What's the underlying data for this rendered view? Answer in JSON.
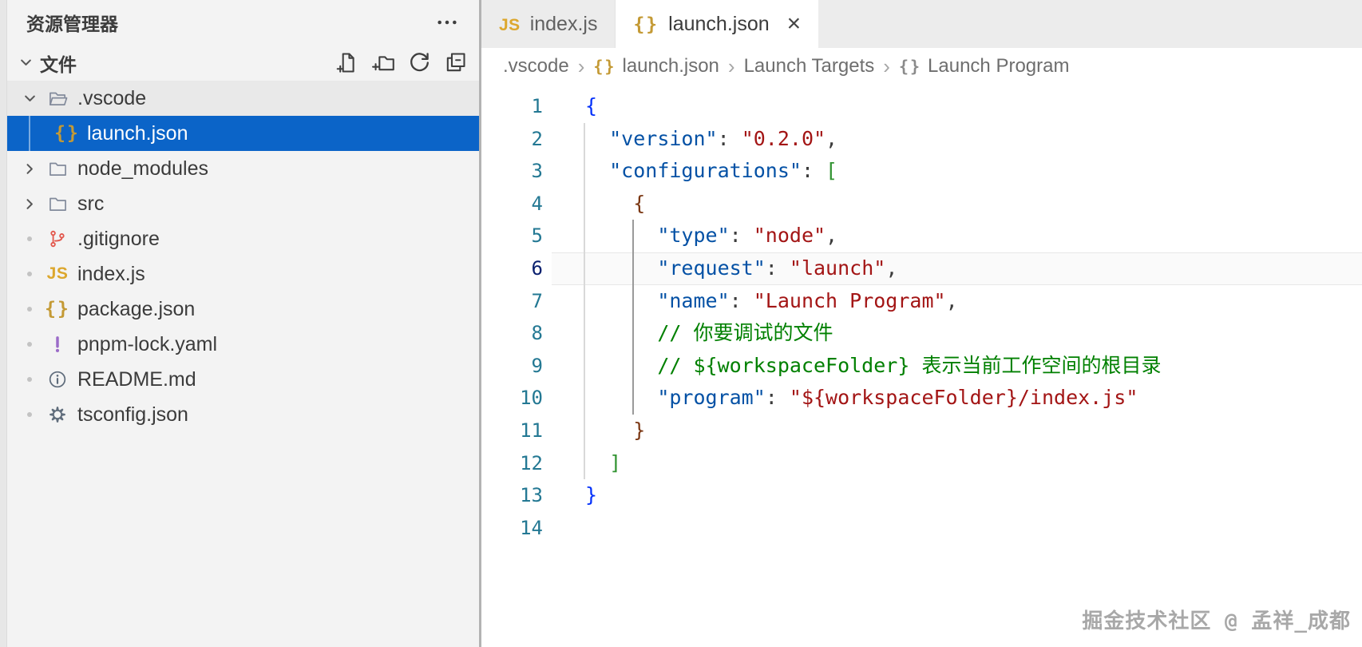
{
  "sidebar": {
    "title": "资源管理器",
    "more_icon": "ellipsis-icon",
    "section": {
      "label": "文件",
      "twisty_icon": "chevron-down-icon",
      "actions": [
        {
          "icon": "new-file-icon"
        },
        {
          "icon": "new-folder-icon"
        },
        {
          "icon": "refresh-icon"
        },
        {
          "icon": "collapse-all-icon"
        }
      ]
    },
    "tree": [
      {
        "label": ".vscode",
        "depth": 0,
        "twisty": "chevron-down-icon",
        "icon": "folder-open-icon",
        "shade": true
      },
      {
        "label": "launch.json",
        "depth": 1,
        "icon": "json-braces-icon",
        "selected": true
      },
      {
        "label": "node_modules",
        "depth": 0,
        "twisty": "chevron-right-icon",
        "icon": "folder-icon"
      },
      {
        "label": "src",
        "depth": 0,
        "twisty": "chevron-right-icon",
        "icon": "folder-icon"
      },
      {
        "label": ".gitignore",
        "depth": 0,
        "dot": true,
        "icon": "git-branch-icon"
      },
      {
        "label": "index.js",
        "depth": 0,
        "dot": true,
        "icon": "js-icon"
      },
      {
        "label": "package.json",
        "depth": 0,
        "dot": true,
        "icon": "json-braces-icon"
      },
      {
        "label": "pnpm-lock.yaml",
        "depth": 0,
        "dot": true,
        "icon": "exclamation-icon"
      },
      {
        "label": "README.md",
        "depth": 0,
        "dot": true,
        "icon": "info-icon"
      },
      {
        "label": "tsconfig.json",
        "depth": 0,
        "dot": true,
        "icon": "gear-icon"
      }
    ]
  },
  "editor": {
    "tabs": [
      {
        "label": "index.js",
        "icon": "js-icon",
        "active": false
      },
      {
        "label": "launch.json",
        "icon": "json-braces-icon",
        "active": true,
        "close_icon": "close-icon",
        "close_glyph": "×"
      }
    ],
    "breadcrumb": [
      {
        "label": ".vscode"
      },
      {
        "label": "launch.json",
        "icon": "json-braces-icon"
      },
      {
        "label": "Launch Targets"
      },
      {
        "label": "Launch Program",
        "icon": "symbol-object-icon"
      }
    ],
    "breadcrumb_separator": "›",
    "active_line": 6,
    "code_lines": [
      {
        "n": "1",
        "tokens": [
          [
            "{",
            "b1"
          ]
        ]
      },
      {
        "n": "2",
        "tokens": [
          [
            "  ",
            "sp"
          ],
          [
            "\"version\"",
            "key"
          ],
          [
            ": ",
            "pun"
          ],
          [
            "\"0.2.0\"",
            "str"
          ],
          [
            ",",
            "pun"
          ]
        ]
      },
      {
        "n": "3",
        "tokens": [
          [
            "  ",
            "sp"
          ],
          [
            "\"configurations\"",
            "key"
          ],
          [
            ": ",
            "pun"
          ],
          [
            "[",
            "b2"
          ]
        ]
      },
      {
        "n": "4",
        "tokens": [
          [
            "    ",
            "sp"
          ],
          [
            "{",
            "b3"
          ]
        ]
      },
      {
        "n": "5",
        "tokens": [
          [
            "      ",
            "sp"
          ],
          [
            "\"type\"",
            "key"
          ],
          [
            ": ",
            "pun"
          ],
          [
            "\"node\"",
            "str"
          ],
          [
            ",",
            "pun"
          ]
        ]
      },
      {
        "n": "6",
        "tokens": [
          [
            "      ",
            "sp"
          ],
          [
            "\"request\"",
            "key"
          ],
          [
            ": ",
            "pun"
          ],
          [
            "\"launch\"",
            "str"
          ],
          [
            ",",
            "pun"
          ]
        ]
      },
      {
        "n": "7",
        "tokens": [
          [
            "      ",
            "sp"
          ],
          [
            "\"name\"",
            "key"
          ],
          [
            ": ",
            "pun"
          ],
          [
            "\"Launch Program\"",
            "str"
          ],
          [
            ",",
            "pun"
          ]
        ]
      },
      {
        "n": "8",
        "tokens": [
          [
            "      ",
            "sp"
          ],
          [
            "// 你要调试的文件",
            "com"
          ]
        ]
      },
      {
        "n": "9",
        "tokens": [
          [
            "      ",
            "sp"
          ],
          [
            "// ${workspaceFolder} 表示当前工作空间的根目录",
            "com"
          ]
        ]
      },
      {
        "n": "10",
        "tokens": [
          [
            "      ",
            "sp"
          ],
          [
            "\"program\"",
            "key"
          ],
          [
            ": ",
            "pun"
          ],
          [
            "\"${workspaceFolder}/index.js\"",
            "str"
          ]
        ]
      },
      {
        "n": "11",
        "tokens": [
          [
            "    ",
            "sp"
          ],
          [
            "}",
            "b3"
          ]
        ]
      },
      {
        "n": "12",
        "tokens": [
          [
            "  ",
            "sp"
          ],
          [
            "]",
            "b2"
          ]
        ]
      },
      {
        "n": "13",
        "tokens": [
          [
            "}",
            "b1"
          ]
        ]
      },
      {
        "n": "14",
        "tokens": []
      }
    ]
  },
  "watermark": "掘金技术社区 @ 孟祥_成都",
  "theme": {
    "selection_blue": "#0B64C8",
    "sidebar_bg": "#F3F3F3",
    "tabbar_bg": "#ECECEC",
    "json_key_color": "#0451A5",
    "string_color": "#A31515",
    "comment_color": "#008000",
    "bracket_level1": "#0431FA",
    "bracket_level2": "#319331",
    "bracket_level3": "#7B3814",
    "line_number_color": "#237893",
    "line_number_active_color": "#0B216F",
    "json_braces_gold": "#C49A35",
    "js_yellow": "#DCA72E"
  }
}
